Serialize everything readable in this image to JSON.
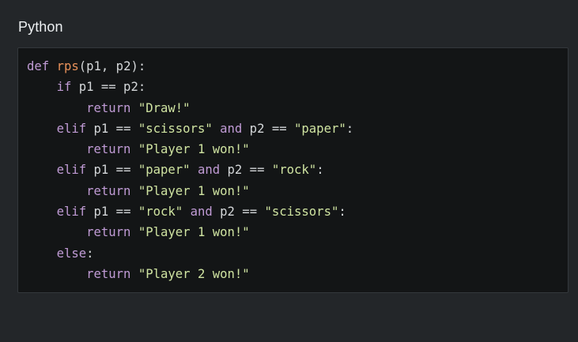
{
  "title": "Python",
  "code": {
    "lines": [
      [
        [
          "kw",
          "def"
        ],
        [
          "op",
          " "
        ],
        [
          "fn",
          "rps"
        ],
        [
          "op",
          "(p1, p2):"
        ]
      ],
      [
        [
          "op",
          "    "
        ],
        [
          "kw",
          "if"
        ],
        [
          "op",
          " p1 == p2:"
        ]
      ],
      [
        [
          "op",
          "        "
        ],
        [
          "kw",
          "return"
        ],
        [
          "op",
          " "
        ],
        [
          "str",
          "\"Draw!\""
        ]
      ],
      [
        [
          "op",
          "    "
        ],
        [
          "kw",
          "elif"
        ],
        [
          "op",
          " p1 == "
        ],
        [
          "str",
          "\"scissors\""
        ],
        [
          "op",
          " "
        ],
        [
          "kw",
          "and"
        ],
        [
          "op",
          " p2 == "
        ],
        [
          "str",
          "\"paper\""
        ],
        [
          "op",
          ":"
        ]
      ],
      [
        [
          "op",
          "        "
        ],
        [
          "kw",
          "return"
        ],
        [
          "op",
          " "
        ],
        [
          "str",
          "\"Player 1 won!\""
        ]
      ],
      [
        [
          "op",
          "    "
        ],
        [
          "kw",
          "elif"
        ],
        [
          "op",
          " p1 == "
        ],
        [
          "str",
          "\"paper\""
        ],
        [
          "op",
          " "
        ],
        [
          "kw",
          "and"
        ],
        [
          "op",
          " p2 == "
        ],
        [
          "str",
          "\"rock\""
        ],
        [
          "op",
          ":"
        ]
      ],
      [
        [
          "op",
          "        "
        ],
        [
          "kw",
          "return"
        ],
        [
          "op",
          " "
        ],
        [
          "str",
          "\"Player 1 won!\""
        ]
      ],
      [
        [
          "op",
          "    "
        ],
        [
          "kw",
          "elif"
        ],
        [
          "op",
          " p1 == "
        ],
        [
          "str",
          "\"rock\""
        ],
        [
          "op",
          " "
        ],
        [
          "kw",
          "and"
        ],
        [
          "op",
          " p2 == "
        ],
        [
          "str",
          "\"scissors\""
        ],
        [
          "op",
          ":"
        ]
      ],
      [
        [
          "op",
          "        "
        ],
        [
          "kw",
          "return"
        ],
        [
          "op",
          " "
        ],
        [
          "str",
          "\"Player 1 won!\""
        ]
      ],
      [
        [
          "op",
          "    "
        ],
        [
          "kw",
          "else"
        ],
        [
          "op",
          ":"
        ]
      ],
      [
        [
          "op",
          "        "
        ],
        [
          "kw",
          "return"
        ],
        [
          "op",
          " "
        ],
        [
          "str",
          "\"Player 2 won!\""
        ]
      ]
    ]
  },
  "colors": {
    "keyword": "#c09bd5",
    "function": "#e8915a",
    "string": "#cfe3a1",
    "text": "#d4d7d9",
    "background": "#131516",
    "panel": "#232629"
  }
}
